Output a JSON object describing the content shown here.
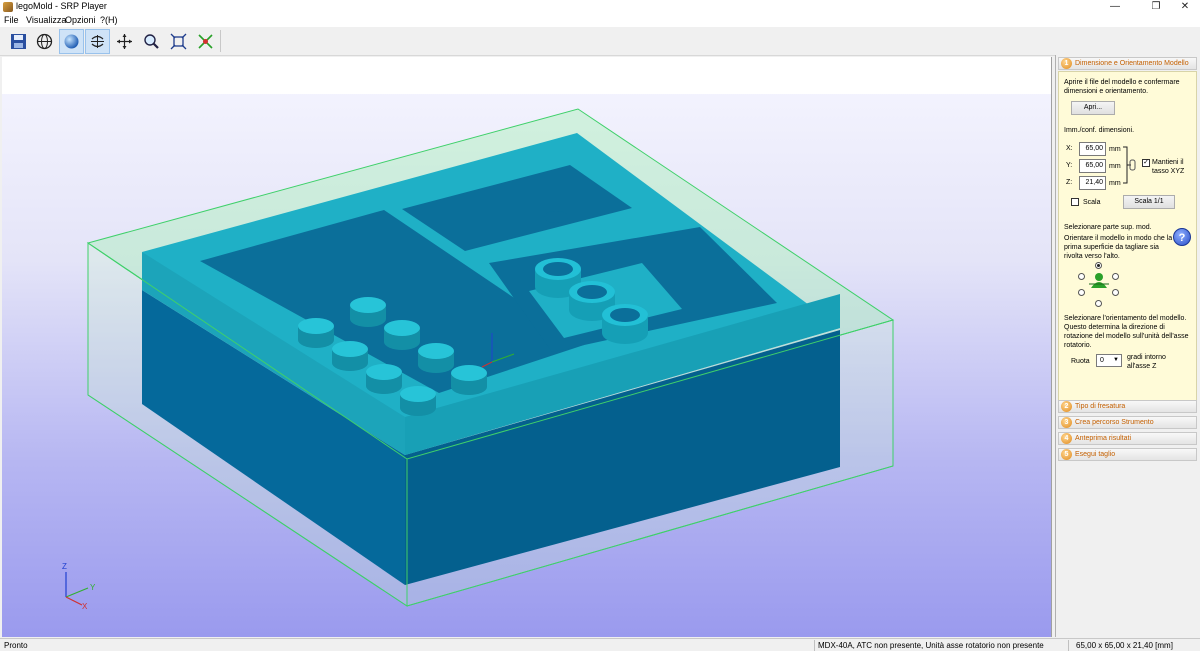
{
  "window": {
    "title": "legoMold - SRP Player"
  },
  "menu": [
    "File",
    "Visualizza",
    "Opzioni",
    "?(H)"
  ],
  "toolbar": {
    "buttons": [
      {
        "name": "save-icon"
      },
      {
        "name": "globe-icon"
      },
      {
        "name": "sphere-icon",
        "active": true
      },
      {
        "name": "rotate-icon",
        "active": true
      },
      {
        "name": "pan-icon"
      },
      {
        "name": "zoom-icon"
      },
      {
        "name": "fit-view-icon"
      },
      {
        "name": "axes-icon"
      }
    ]
  },
  "viewport": {
    "axis_labels": {
      "z": "Z",
      "y": "Y",
      "x": "X"
    }
  },
  "panel": {
    "section1": {
      "number": "1",
      "title": "Dimensione e Orientamento Modello",
      "intro": "Aprire il file del modello e confermare dimensioni e orientamento.",
      "open_button": "Apri...",
      "dims_label": "Imm./conf. dimensioni.",
      "x_label": "X:",
      "x_value": "65,00",
      "y_label": "Y:",
      "y_value": "65,00",
      "z_label": "Z:",
      "z_value": "21,40",
      "unit": "mm",
      "keep_ratio_label": "Mantieni il tasso XYZ",
      "scale_label": "Scala",
      "scale_button": "Scala 1/1",
      "surface_title": "Selezionare parte sup. mod.",
      "surface_desc": "Orientare il modello in modo che la prima superficie da tagliare sia rivolta verso l'alto.",
      "help": "?",
      "orientation_desc": "Selezionare l'orientamento del modello. Questo determina la direzione di rotazione del modello sull'unità dell'asse rotatorio.",
      "rotate_label": "Ruota",
      "rotate_value": "0",
      "rotate_suffix": "gradi intorno all'asse Z"
    },
    "section2": {
      "number": "2",
      "title": "Tipo di fresatura"
    },
    "section3": {
      "number": "3",
      "title": "Crea percorso Strumento"
    },
    "section4": {
      "number": "4",
      "title": "Anteprima risultati"
    },
    "section5": {
      "number": "5",
      "title": "Esegui taglio"
    }
  },
  "status": {
    "left": "Pronto",
    "machine": "MDX-40A, ATC non presente, Unità asse rotatorio non presente",
    "size": "65,00 x  65,00 x  21,40 [mm]"
  },
  "colors": {
    "model_top": "#1fb0c6",
    "model_front": "#04608e",
    "bounding_box": "#3fd06a"
  }
}
